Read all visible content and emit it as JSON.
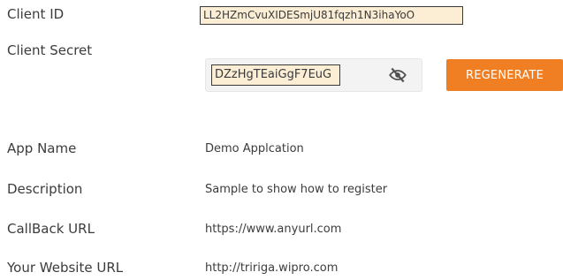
{
  "client_id": {
    "label": "Client ID",
    "value": "LL2HZmCvuXIDESmjU81fqzh1N3ihaYoO"
  },
  "client_secret": {
    "label": "Client Secret",
    "value": "DZzHgTEaiGgF7EuG",
    "toggle_icon": "eye-slash-icon",
    "regenerate_label": "REGENERATE",
    "accent_color": "#ef7f22"
  },
  "fields": {
    "app_name": {
      "label": "App Name",
      "value": "Demo Applcation"
    },
    "description": {
      "label": "Description",
      "value": "Sample to show how to register"
    },
    "callback_url": {
      "label": "CallBack URL",
      "value": "https://www.anyurl.com"
    },
    "website_url": {
      "label": "Your Website URL",
      "value": "http://tririga.wipro.com"
    }
  }
}
